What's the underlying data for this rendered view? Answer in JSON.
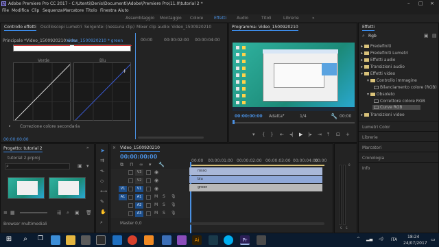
{
  "title_bar": {
    "app_badge": "Pr",
    "title": "Adobe Premiere Pro CC 2017 - C:\\Utenti\\Denis\\Documenti\\Adobe\\Premiere Pro\\11.0\\tutorial 2 *"
  },
  "menu": [
    "File",
    "Modifica",
    "Clip",
    "Sequenza",
    "Marcatore",
    "Titolo",
    "Finestra",
    "Aiuto"
  ],
  "workspaces": {
    "items": [
      "Assemblaggio",
      "Montaggio",
      "Colore",
      "Effetti",
      "Audio",
      "Titoli",
      "Librerie"
    ],
    "active": "Effetti"
  },
  "source_panel": {
    "tabs": [
      "Controllo effetti",
      "Oscilloscopi Lumetri",
      "Sorgente: (nessuna clip)",
      "Mixer clip audio: Video_1500920210"
    ],
    "active_tab": "Controllo effetti",
    "master_label": "Principale *Video_1500920210.wmv",
    "clip_label": "Video_1500920210 * green",
    "timecodes": [
      "00:00",
      "00:00:02:00",
      "00:00:04:00"
    ],
    "curve_labels": [
      "Verde",
      "Blu"
    ],
    "secondary": "Correzione colore secondaria",
    "bottom_timecode": "00:00:00:00"
  },
  "program_monitor": {
    "tab": "Programma: Video_1500920210",
    "timecode": "00:00:00:00",
    "fit": "Adatta",
    "quality": "1/4",
    "end_timecode": "00:00"
  },
  "effects_panel": {
    "tab": "Effetti",
    "search_value": "Rgb",
    "tree": [
      {
        "label": "Predefiniti",
        "type": "folder"
      },
      {
        "label": "Predefiniti Lumetri",
        "type": "folder"
      },
      {
        "label": "Effetti audio",
        "type": "folder"
      },
      {
        "label": "Transizioni audio",
        "type": "folder"
      },
      {
        "label": "Effetti video",
        "type": "folder"
      },
      {
        "label": "Controllo immagine",
        "type": "folder"
      },
      {
        "label": "Bilanciamento colore (RGB)",
        "type": "effect"
      },
      {
        "label": "Obsoleto",
        "type": "folder"
      },
      {
        "label": "Correttore colore RGB",
        "type": "effect"
      },
      {
        "label": "Curve RGB",
        "type": "effect"
      },
      {
        "label": "Transizioni video",
        "type": "folder"
      }
    ],
    "side_items": [
      "Lumetri Color",
      "Librerie",
      "Marcatori",
      "Cronologia",
      "Info"
    ]
  },
  "project_panel": {
    "tab": "Progetto: tutorial 2",
    "file": "tutorial 2.prproj",
    "bottom_label": "Browser multimediali"
  },
  "timeline": {
    "tab": "Video_1500920210",
    "timecode": "00:00:00:00",
    "ruler": [
      "00:00",
      "00:00:01:00",
      "00:00:02:00",
      "00:00:03:00",
      "00:00:04:00",
      "00:00"
    ],
    "video_tracks": [
      "V3",
      "V2",
      "V1"
    ],
    "audio_tracks": [
      "A1",
      "A2",
      "A3"
    ],
    "source_patch": [
      "V1",
      "A1"
    ],
    "clips": [
      {
        "label": "rosso",
        "color": "#a9b8d8"
      },
      {
        "label": "blu",
        "color": "#8fa8d8"
      },
      {
        "label": "green",
        "color": "#b8b8b8"
      }
    ]
  },
  "taskbar": {
    "time": "18:24",
    "date": "24/07/2017",
    "language": "ITA",
    "app_icons": [
      "windows-icon",
      "search-icon",
      "taskview-icon",
      "edge-icon",
      "explorer-icon",
      "store-icon",
      "media-icon",
      "chrome-icon",
      "opera-icon",
      "vlc-icon",
      "illustrator-icon",
      "photos-icon",
      "skype-icon",
      "premiere-icon",
      "vegas-icon",
      "app-icon"
    ]
  },
  "colors": {
    "accent": "#4a90e2",
    "panel": "#232323",
    "taskbar": "#0b1b2e"
  }
}
